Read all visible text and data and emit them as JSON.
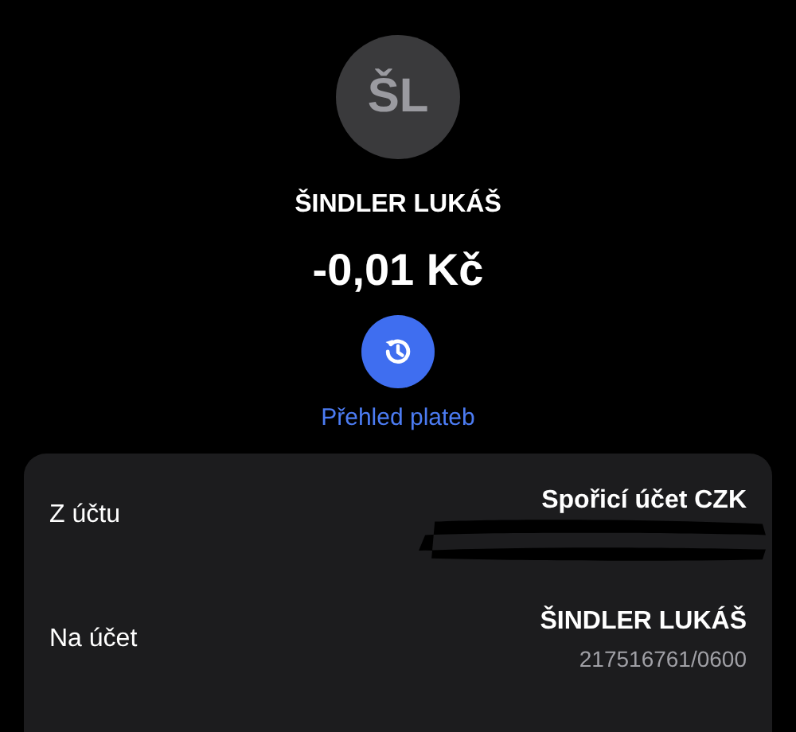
{
  "contact": {
    "initials": "ŠL",
    "name": "ŠINDLER LUKÁŠ"
  },
  "amount": "-0,01 Kč",
  "history_link": "Přehled plateb",
  "details": [
    {
      "label": "Z účtu",
      "value": "Spořicí účet CZK"
    },
    {
      "label": "Na účet",
      "value": "ŠINDLER LUKÁŠ",
      "sub": "217516761/0600"
    }
  ]
}
